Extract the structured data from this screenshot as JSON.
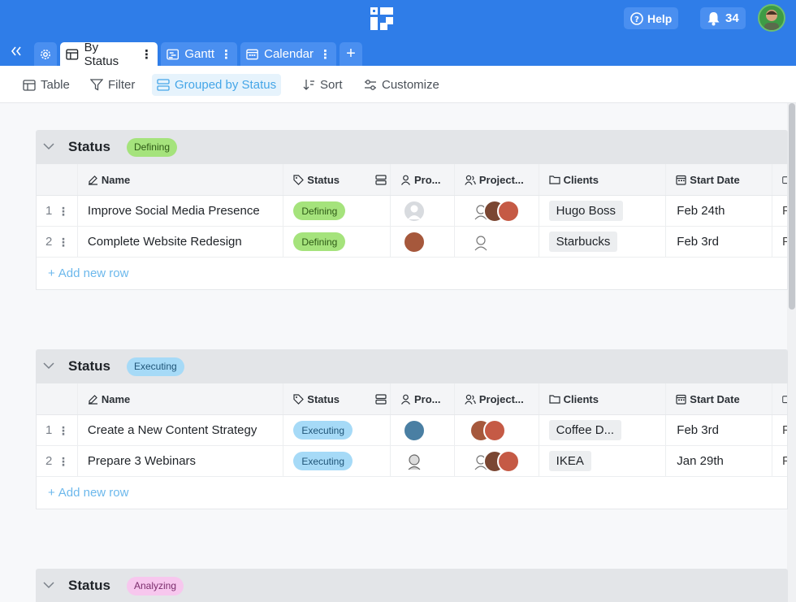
{
  "topbar": {
    "help_label": "Help",
    "notifications_count": "34",
    "colors": {
      "bar": "#2f7de8",
      "button": "#4a8ff0"
    }
  },
  "tabs": [
    {
      "label": "By Status",
      "icon": "table-icon",
      "active": true
    },
    {
      "label": "Gantt",
      "icon": "gantt-icon",
      "active": false
    },
    {
      "label": "Calendar",
      "icon": "calendar-icon",
      "active": false
    }
  ],
  "toolbar": {
    "table": "Table",
    "filter": "Filter",
    "grouped": "Grouped by Status",
    "sort": "Sort",
    "customize": "Customize"
  },
  "columns": {
    "name": "Name",
    "status": "Status",
    "pro": "Pro...",
    "project": "Project...",
    "clients": "Clients",
    "start_date": "Start Date"
  },
  "groups": [
    {
      "title": "Status",
      "badge": "Defining",
      "rows": [
        {
          "idx": "1",
          "name": "Improve Social Media Presence",
          "status": "Defining",
          "client": "Hugo Boss",
          "date": "Feb 24th"
        },
        {
          "idx": "2",
          "name": "Complete Website Redesign",
          "status": "Defining",
          "client": "Starbucks",
          "date": "Feb 3rd"
        }
      ],
      "add_row": "Add new row"
    },
    {
      "title": "Status",
      "badge": "Executing",
      "rows": [
        {
          "idx": "1",
          "name": "Create a New Content Strategy",
          "status": "Executing",
          "client": "Coffee D...",
          "date": "Feb 3rd"
        },
        {
          "idx": "2",
          "name": "Prepare 3 Webinars",
          "status": "Executing",
          "client": "IKEA",
          "date": "Jan 29th"
        }
      ],
      "add_row": "Add new row"
    },
    {
      "title": "Status",
      "badge": "Analyzing"
    }
  ],
  "status_colors": {
    "Defining": "#a5e37c",
    "Executing": "#a6daf7",
    "Analyzing": "#f7c7ee"
  }
}
